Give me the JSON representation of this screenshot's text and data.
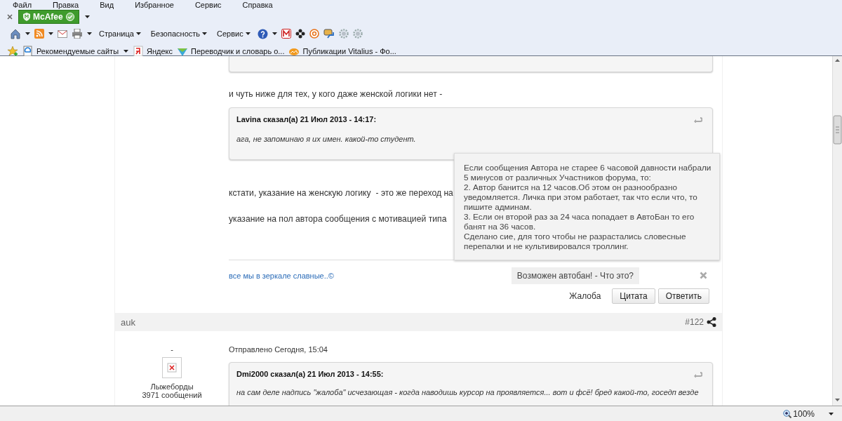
{
  "menu_bar": {
    "items": [
      "Файл",
      "Правка",
      "Вид",
      "Избранное",
      "Сервис",
      "Справка"
    ]
  },
  "addon_bar": {
    "label": "McAfee"
  },
  "command_bar": {
    "menus": [
      "Страница",
      "Безопасность",
      "Сервис"
    ]
  },
  "favorites_bar": {
    "items": [
      {
        "label": "Рекомендуемые сайты",
        "dropdown": true
      },
      {
        "label": "Яндекс",
        "dropdown": false
      },
      {
        "label": "Переводчик и словарь о...",
        "dropdown": false
      },
      {
        "label": "Публикации Vitalius - Фо...",
        "dropdown": false
      }
    ]
  },
  "post_above": {
    "blocks": [
      {
        "kind": "quote_cut"
      },
      {
        "kind": "text",
        "text": "и чуть ниже для тех, у кого даже женской логики нет -"
      },
      {
        "kind": "quote",
        "author": "Lavina сказал(а) 21 Июл 2013 - 14:17:",
        "text": "ага, не запоминаю я их имен. какой-то студент."
      },
      {
        "kind": "text",
        "text": "кстати, указание на женскую логику  - это же переход на"
      },
      {
        "kind": "text",
        "text": "указание на пол автора сообщения с мотивацией типа"
      }
    ],
    "signature": "все мы в зеркале славные..©",
    "autoban_tooltip": {
      "paragraphs": [
        "Если сообщения Автора не старее 6 часовой давности набрали 5 минусов от различных Участников форума, то:",
        "2. Автор банится на 12 часов.Об этом он разнообразно уведомляется. Личка при этом работает, так что если что, то пишите админам.",
        "3. Если он второй раз за 24 часа попадает в АвтоБан то его банят на 36 часов.",
        "Сделано сие, для того чтобы не разрастались словесные перепалки и не культивировался троллинг."
      ]
    },
    "autoban_link": "Возможен автобан! - Что это?",
    "actions": {
      "report": "Жалоба",
      "buttons": [
        "Цитата",
        "Ответить"
      ]
    }
  },
  "post": {
    "author": "auk",
    "number": "#122",
    "rank": "-",
    "group": "Лыжеборды",
    "post_count": "3971 сообщений",
    "posted": "Отправлено Сегодня, 15:04",
    "quote": {
      "author": "Dmi2000 сказал(а) 21 Июл 2013 - 14:55:",
      "text": "на сам деле надпись \"жалоба\" исчезающая - когда наводишь курсор на проявляется... вот и фсё! бред какой-то, госедп везде"
    }
  },
  "status_bar": {
    "zoom": "100%"
  }
}
